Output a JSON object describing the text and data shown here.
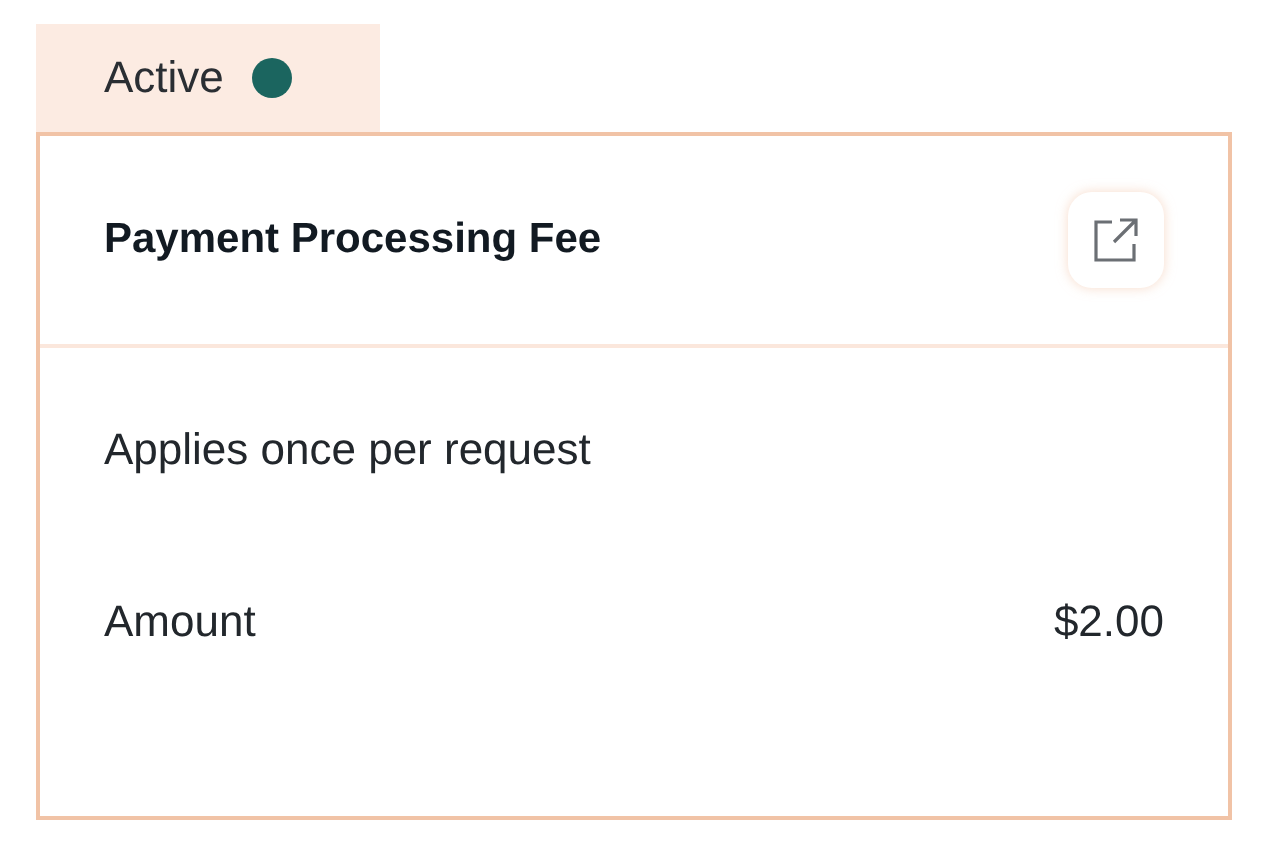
{
  "status": {
    "label": "Active",
    "color": "#1b655f"
  },
  "card": {
    "title": "Payment Processing Fee",
    "description": "Applies once per request",
    "amount_label": "Amount",
    "amount": "$2.00"
  }
}
